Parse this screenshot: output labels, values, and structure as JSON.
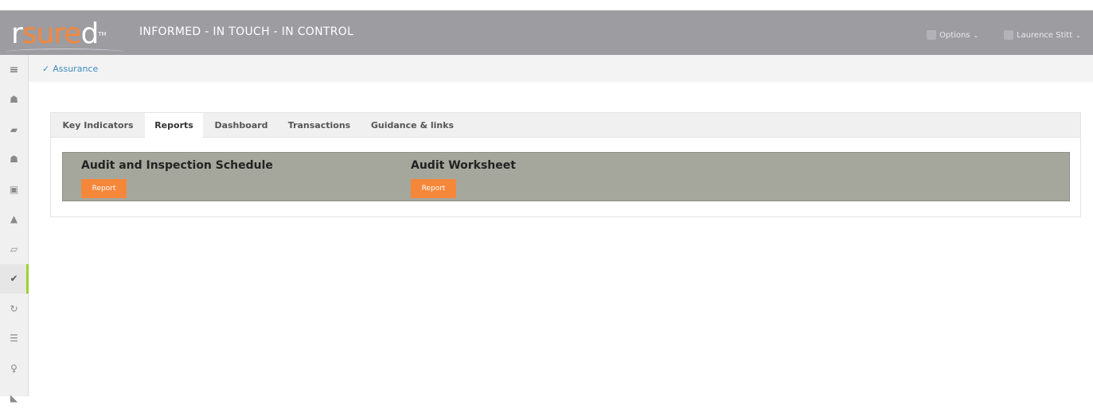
{
  "header": {
    "logo": {
      "part1": "r",
      "part2": "sure",
      "part3": "d",
      "tm": "TM"
    },
    "tagline": "INFORMED - IN TOUCH - IN CONTROL",
    "options_label": "Options",
    "user_label": "Laurence Stitt"
  },
  "sidebar": {
    "items": [
      {
        "icon": "≡",
        "name": "menu-icon"
      },
      {
        "icon": "☗",
        "name": "people-icon"
      },
      {
        "icon": "▰",
        "name": "vehicle-icon"
      },
      {
        "icon": "☗",
        "name": "groups-icon"
      },
      {
        "icon": "▣",
        "name": "medical-kit-icon"
      },
      {
        "icon": "▲",
        "name": "warning-icon"
      },
      {
        "icon": "▱",
        "name": "document-icon"
      },
      {
        "icon": "✔",
        "name": "assurance-check-icon"
      },
      {
        "icon": "↻",
        "name": "refresh-icon"
      },
      {
        "icon": "☰",
        "name": "list-icon"
      },
      {
        "icon": "♀",
        "name": "location-pin-icon"
      },
      {
        "icon": "◣",
        "name": "chart-icon"
      }
    ]
  },
  "breadcrumb": {
    "check": "✓",
    "label": "Assurance"
  },
  "tabs": [
    {
      "label": "Key Indicators"
    },
    {
      "label": "Reports"
    },
    {
      "label": "Dashboard"
    },
    {
      "label": "Transactions"
    },
    {
      "label": "Guidance & links"
    }
  ],
  "reports": [
    {
      "title": "Audit and Inspection Schedule",
      "button": "Report"
    },
    {
      "title": "Audit Worksheet",
      "button": "Report"
    }
  ],
  "colors": {
    "header_bg": "#9d9ca1",
    "accent_orange": "#f5873a",
    "report_bar": "#a6a79c",
    "active_indicator": "#9bd22f",
    "link_blue": "#3b8bbf"
  }
}
